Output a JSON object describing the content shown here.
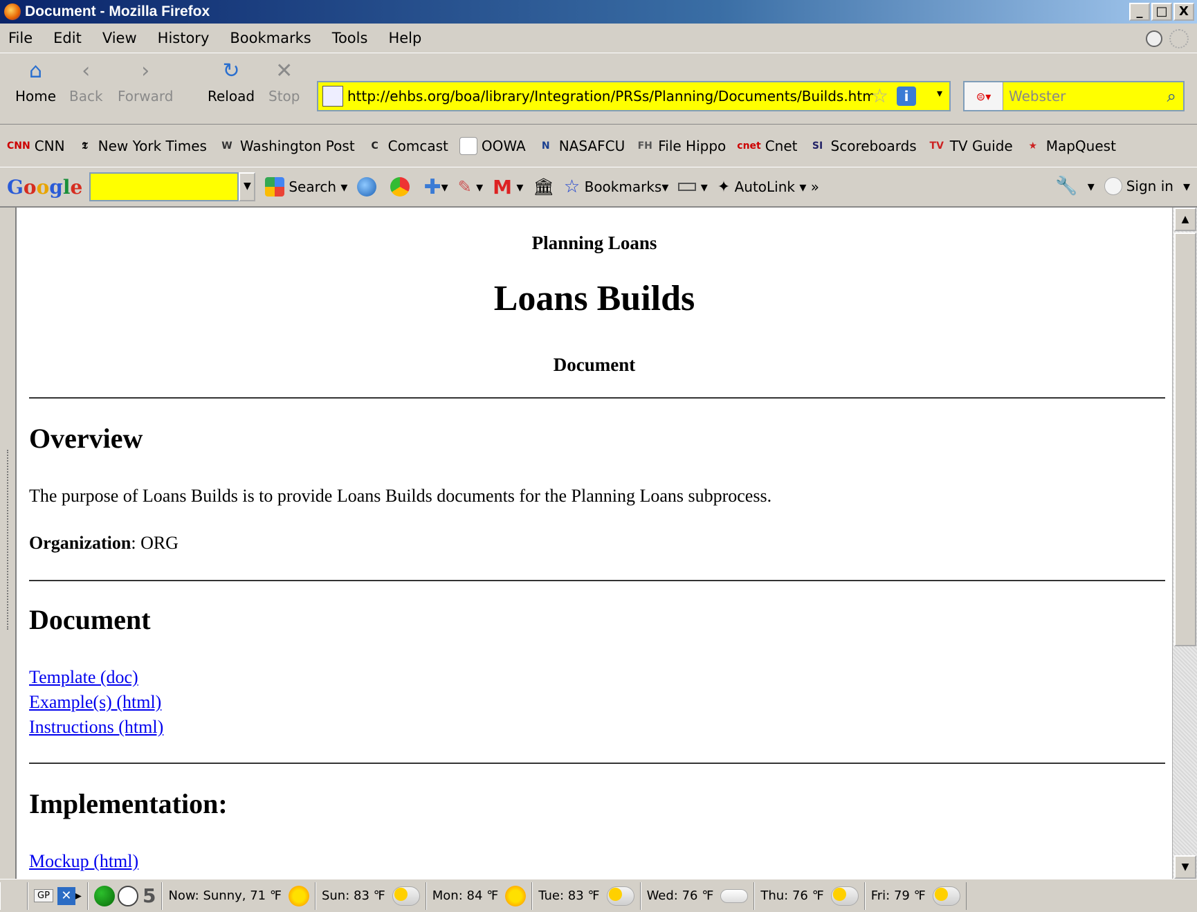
{
  "window": {
    "title": "Document - Mozilla Firefox",
    "minimize": "_",
    "maximize": "□",
    "close": "X"
  },
  "menu": [
    "File",
    "Edit",
    "View",
    "History",
    "Bookmarks",
    "Tools",
    "Help"
  ],
  "nav": {
    "home": "Home",
    "back": "Back",
    "forward": "Forward",
    "reload": "Reload",
    "stop": "Stop",
    "url": "http://ehbs.org/boa/library/Integration/PRSs/Planning/Documents/Builds.htm",
    "search_placeholder": "Webster"
  },
  "bookmarks": [
    {
      "label": "CNN",
      "icon": "CNN",
      "color": "#cc0000"
    },
    {
      "label": "New York Times",
      "icon": "𝕿",
      "color": "#000000"
    },
    {
      "label": "Washington Post",
      "icon": "W",
      "color": "#333333"
    },
    {
      "label": "Comcast",
      "icon": "C",
      "color": "#222222"
    },
    {
      "label": "OOWA",
      "icon": "",
      "color": "#ffffff"
    },
    {
      "label": "NASAFCU",
      "icon": "N",
      "color": "#1a3f8f"
    },
    {
      "label": "File Hippo",
      "icon": "FH",
      "color": "#555555"
    },
    {
      "label": "Cnet",
      "icon": "cnet",
      "color": "#cc0000"
    },
    {
      "label": "Scoreboards",
      "icon": "SI",
      "color": "#222266"
    },
    {
      "label": "TV Guide",
      "icon": "TV",
      "color": "#cc2222"
    },
    {
      "label": "MapQuest",
      "icon": "★",
      "color": "#cc2222"
    }
  ],
  "google_bar": {
    "logo": [
      "G",
      "o",
      "o",
      "g",
      "l",
      "e"
    ],
    "search": "Search",
    "bookmarks": "Bookmarks",
    "autolink": "AutoLink",
    "more": "»",
    "sign_in": "Sign in"
  },
  "page": {
    "kicker": "Planning Loans",
    "title": "Loans Builds",
    "subtitle": "Document",
    "overview_heading": "Overview",
    "overview_text": "The purpose of Loans Builds is to provide Loans Builds documents for the Planning Loans subprocess.",
    "org_label": "Organization",
    "org_value": ": ORG",
    "document_heading": "Document",
    "document_links": [
      "Template (doc)",
      "Example(s) (html)",
      "Instructions (html)"
    ],
    "implementation_heading": "Implementation:",
    "implementation_links": [
      "Mockup (html)"
    ]
  },
  "status": {
    "gp": "GP",
    "count": "5",
    "weather": [
      {
        "label": "Now: Sunny, 71 ℉",
        "icon": "sun"
      },
      {
        "label": "Sun: 83 ℉",
        "icon": "cloudsun"
      },
      {
        "label": "Mon: 84 ℉",
        "icon": "sun"
      },
      {
        "label": "Tue: 83 ℉",
        "icon": "cloudsun"
      },
      {
        "label": "Wed: 76 ℉",
        "icon": "cloud"
      },
      {
        "label": "Thu: 76 ℉",
        "icon": "cloudsun"
      },
      {
        "label": "Fri: 79 ℉",
        "icon": "cloudsun"
      }
    ]
  }
}
